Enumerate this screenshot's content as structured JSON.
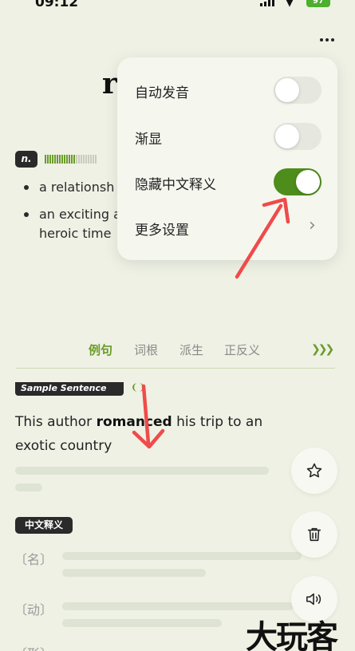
{
  "status_bar": {
    "time": "09:12",
    "battery": "97",
    "battery_color": "#4caf2e"
  },
  "word": {
    "visible_title": "r",
    "pos": "n.",
    "definitions": [
      {
        "lines": [
          "a relationsh"
        ]
      },
      {
        "lines": [
          "an exciting a",
          "heroic time"
        ]
      }
    ]
  },
  "popup": {
    "rows": [
      {
        "label": "自动发音",
        "toggle": false
      },
      {
        "label": "渐显",
        "toggle": false
      },
      {
        "label": "隐藏中文释义",
        "toggle": true
      },
      {
        "label": "更多设置",
        "chevron": true
      }
    ],
    "toggle_on_color": "#4e8d1c"
  },
  "tabs": [
    "例句",
    "词根",
    "派生",
    "正反义"
  ],
  "active_tab": "例句",
  "sample": {
    "label": "Sample Sentence",
    "text_before": "This author ",
    "text_bold": "romanced",
    "text_after": " his trip to an exotic country"
  },
  "chinese": {
    "label": "中文释义",
    "pos_items": [
      "〔名〕",
      "〔动〕",
      "〔形〕"
    ]
  },
  "side_buttons": [
    "star-icon",
    "trash-icon",
    "speaker-icon"
  ],
  "watermark": "大玩客",
  "accent_color": "#6b9b2a",
  "annotation_color": "#f04a4a"
}
